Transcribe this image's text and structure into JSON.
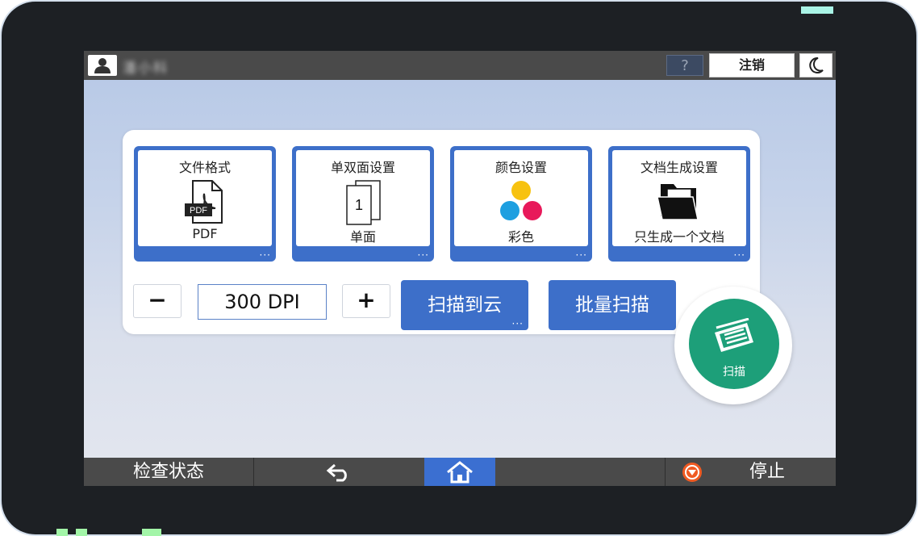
{
  "header": {
    "user_name": "潘小科",
    "help_label": "?",
    "logout_label": "注销"
  },
  "tiles": [
    {
      "title": "文件格式",
      "value": "PDF",
      "icon": "pdf-file-icon",
      "badge": "PDF",
      "more": "···"
    },
    {
      "title": "单双面设置",
      "value": "单面",
      "icon": "single-sided-page-icon",
      "page_number": "1",
      "more": "···"
    },
    {
      "title": "颜色设置",
      "value": "彩色",
      "icon": "color-circles-icon",
      "more": "···"
    },
    {
      "title": "文档生成设置",
      "value": "只生成一个文档",
      "icon": "folder-icon",
      "more": "···"
    }
  ],
  "resolution": {
    "minus_label": "−",
    "value": "300 DPI",
    "plus_label": "+"
  },
  "actions": {
    "scan_to_cloud": "扫描到云",
    "scan_to_cloud_more": "···",
    "batch_scan": "批量扫描",
    "start_scan": "扫描"
  },
  "footer": {
    "check_status": "检查状态",
    "stop": "停止"
  },
  "colors": {
    "accent_blue": "#3d6fc9",
    "scan_green": "#1d9f79",
    "bar_gray": "#4a4a4a",
    "home_blue": "#3b6fd1",
    "stop_orange": "#f05a22"
  }
}
